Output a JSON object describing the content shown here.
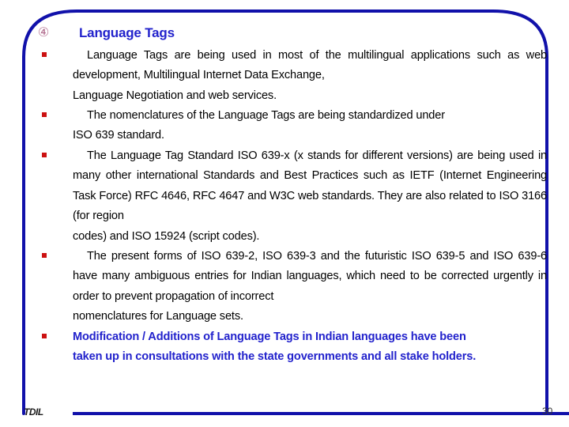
{
  "slide": {
    "marker": "④",
    "title": "Language Tags",
    "accent_color": "#2222cc",
    "bullet_color": "#cc1111",
    "frame_color": "#1111aa",
    "bullets": [
      {
        "id": "bullet-1",
        "glyph": "§",
        "lines": [
          "Language Tags are being used in most of the multilingual applications",
          "such as web development, Multilingual Internet Data Exchange,",
          "Language Negotiation and web services."
        ],
        "text": "Language Tags are being used in most of the multilingual applications such as web development, Multilingual Internet Data Exchange, Language Negotiation and web services."
      },
      {
        "id": "bullet-2",
        "glyph": "§",
        "lines": [
          "The nomenclatures of the Language Tags are being standardized under",
          "ISO 639 standard."
        ],
        "text": "The nomenclatures of the Language Tags are being standardized under ISO 639 standard."
      },
      {
        "id": "bullet-3",
        "glyph": "§",
        "lines": [
          "The Language Tag Standard ISO 639-x (x stands for different versions)",
          "are being used in many other international Standards and Best Practices",
          "such as IETF (Internet Engineering Task Force) RFC 4646, RFC 4647",
          "and W3C web standards. They are also related to ISO 3166 (for region",
          "codes) and ISO 15924 (script codes)."
        ],
        "text": "The Language Tag Standard ISO 639-x (x stands for different versions) are being used in many other international Standards and Best Practices such as IETF (Internet Engineering Task Force) RFC 4646, RFC 4647 and W3C web standards. They are also related to ISO 3166 (for region codes) and ISO 15924 (script codes)."
      },
      {
        "id": "bullet-4",
        "glyph": "§",
        "lines": [
          "The present forms of ISO 639-2, ISO 639-3 and the futuristic ISO 639-5",
          "and ISO 639-6 have many ambiguous entries for Indian languages, which",
          "need to be corrected urgently in order to prevent propagation of incorrect",
          "nomenclatures for Language sets."
        ],
        "text": "The present forms of ISO 639-2, ISO 639-3 and the futuristic ISO 639-5 and ISO 639-6 have many ambiguous entries for Indian languages, which need to be corrected urgently in order to prevent propagation of incorrect nomenclatures for Language sets."
      },
      {
        "id": "bullet-5",
        "glyph": "§",
        "lines": [
          "Modification / Additions of Language Tags in Indian languages have been",
          "taken up in consultations with the state governments and all stake holders."
        ],
        "text": "Modification / Additions of Language Tags in Indian languages have been taken up in consultations with the state governments and all stake holders."
      }
    ]
  },
  "footer": {
    "brand": "TDIL",
    "page_number": "30"
  }
}
